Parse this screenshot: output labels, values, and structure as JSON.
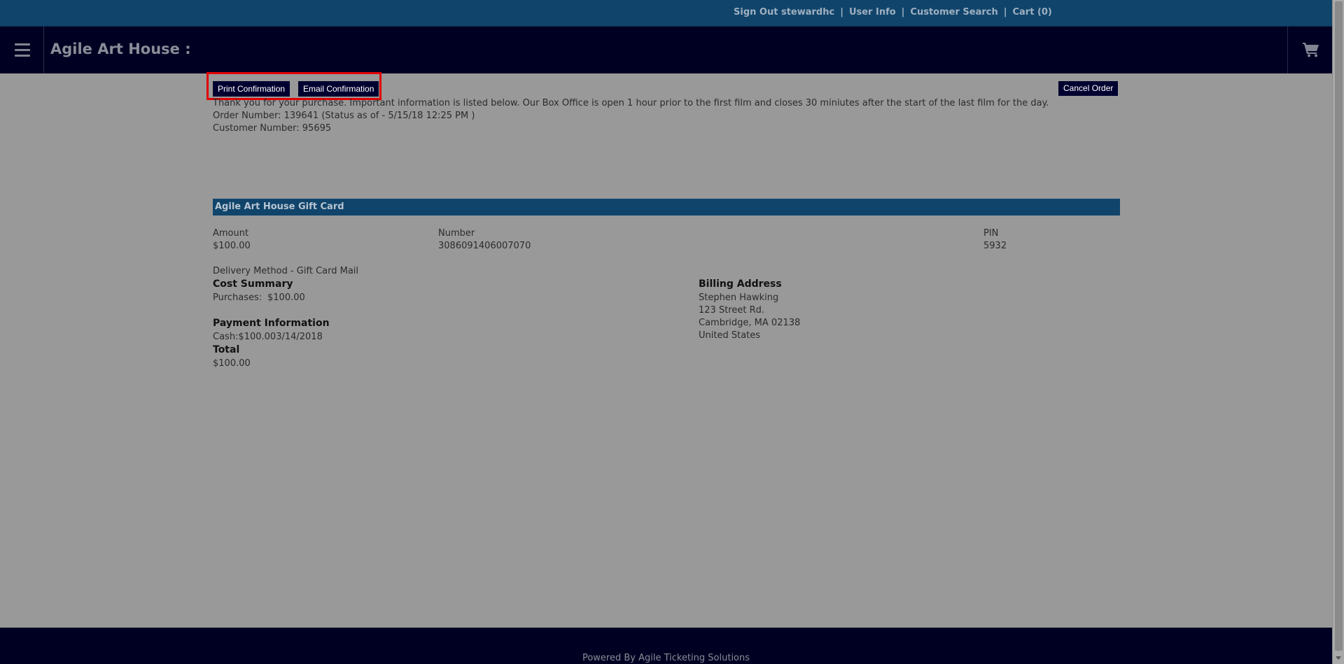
{
  "topbar": {
    "sign_out": "Sign Out stewardhc",
    "user_info": "User Info",
    "customer_search": "Customer Search",
    "cart": "Cart (0)",
    "separator": "|"
  },
  "header": {
    "brand": "Agile Art House :",
    "menu_icon": "hamburger-icon",
    "cart_icon": "shopping-cart-icon"
  },
  "actions": {
    "print_confirmation": "Print Confirmation",
    "email_confirmation": "Email Confirmation",
    "cancel_order": "Cancel Order"
  },
  "order": {
    "thank_you": "Thank you for your purchase. Important information is listed below. Our Box Office is open 1 hour prior to the first film and closes 30 miniutes after the start of the last film for the day.",
    "order_number": "Order Number: 139641 (Status as of - 5/15/18 12:25 PM )",
    "customer_number": "Customer Number: 95695"
  },
  "gift_card": {
    "title": "Agile Art House Gift Card",
    "amount_label": "Amount",
    "amount_value": "$100.00",
    "number_label": "Number",
    "number_value": "3086091406007070",
    "pin_label": "PIN",
    "pin_value": "5932",
    "delivery_method": "Delivery Method - Gift Card Mail"
  },
  "cost_summary": {
    "title": "Cost Summary",
    "purchases_label": "Purchases:",
    "purchases_value": "$100.00"
  },
  "payment": {
    "title": "Payment Information",
    "line": "Cash:$100.003/14/2018"
  },
  "total": {
    "title": "Total",
    "value": "$100.00"
  },
  "billing": {
    "title": "Billing Address",
    "name": "Stephen Hawking",
    "street": "123 Street Rd.",
    "city": "Cambridge, MA 02138",
    "country": "United States"
  },
  "footer": {
    "text": "Powered By Agile Ticketing Solutions"
  },
  "colors": {
    "topbar": "#10446b",
    "header": "#000022",
    "overlay_bg": "#999999",
    "highlight": "#e00000"
  }
}
